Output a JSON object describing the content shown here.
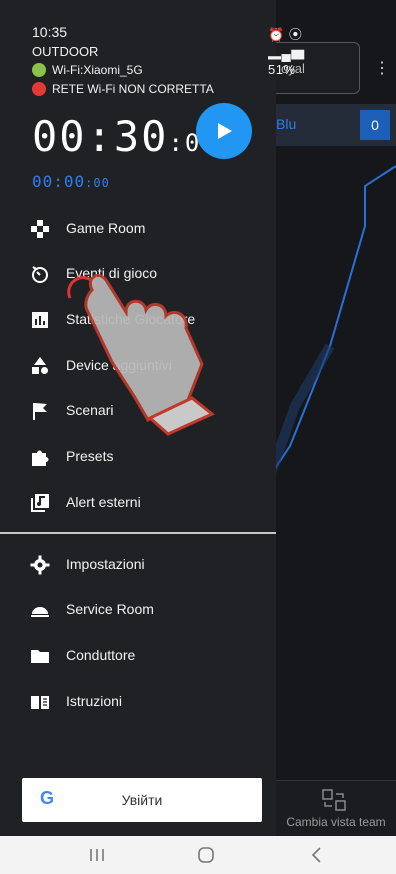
{
  "status": {
    "time": "10:35",
    "right": "51%"
  },
  "drawer": {
    "mode": "OUTDOOR",
    "wifi_name": "Wi-Fi:Xiaomi_5G",
    "wifi_warning": "RETE Wi-Fi NON CORRETTA",
    "timer_main": "00:30",
    "timer_main_frac": ":00",
    "timer_secondary": "00:00",
    "timer_secondary_frac": ":00",
    "menu": [
      {
        "label": "Game Room",
        "icon": "gamepad-icon"
      },
      {
        "label": "Eventi di gioco",
        "icon": "timer-icon"
      },
      {
        "label": "Statistiche Giocatore",
        "icon": "bar-chart-icon"
      },
      {
        "label": "Device aggiuntivi",
        "icon": "shapes-icon"
      },
      {
        "label": "Scenari",
        "icon": "flag-icon"
      },
      {
        "label": "Presets",
        "icon": "puzzle-icon"
      },
      {
        "label": "Alert esterni",
        "icon": "music-alert-icon"
      }
    ],
    "menu2": [
      {
        "label": "Impostazioni",
        "icon": "gear-icon"
      },
      {
        "label": "Service Room",
        "icon": "bell-icon"
      },
      {
        "label": "Conduttore",
        "icon": "folder-icon"
      },
      {
        "label": "Istruzioni",
        "icon": "book-icon"
      }
    ],
    "login_label": "Увійти",
    "google_g": "G"
  },
  "background": {
    "field_text": "oyal",
    "team_label": "Blu",
    "team_score": "0",
    "switch_label": "Cambia vista team",
    "more": "⋮"
  },
  "colors": {
    "accent_blue": "#2196f3",
    "drawer_bg": "#202124",
    "wifi_ok": "#8bc34a",
    "wifi_bad": "#e53935"
  }
}
